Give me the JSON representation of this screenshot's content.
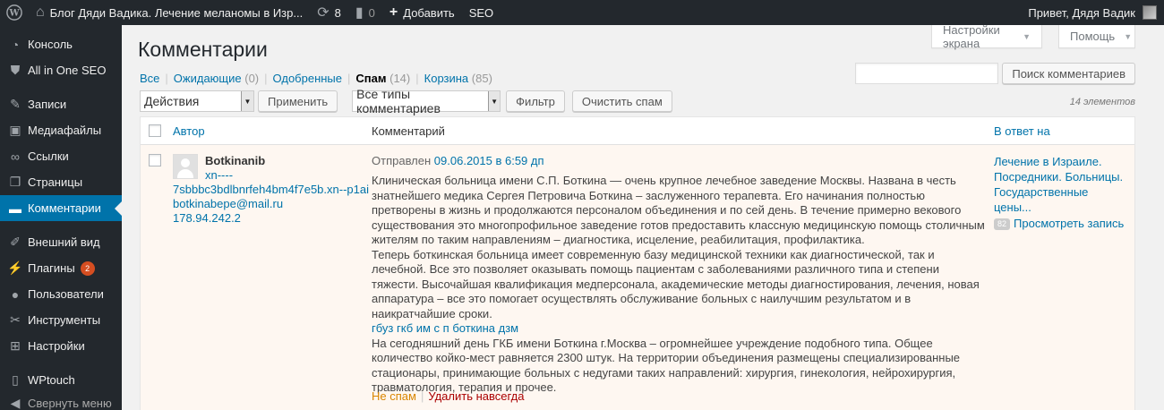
{
  "adminbar": {
    "site_title": "Блог Дяди Вадика. Лечение меланомы в Изр...",
    "updates_count": "8",
    "comments_count": "0",
    "add_label": "Добавить",
    "seo_label": "SEO",
    "greeting": "Привет, Дядя Вадик"
  },
  "sidebar": {
    "items": [
      {
        "label": "Консоль",
        "icon": "dashboard-icon"
      },
      {
        "label": "All in One SEO",
        "icon": "shield-icon"
      },
      {
        "label": "Записи",
        "icon": "pin-icon"
      },
      {
        "label": "Медиафайлы",
        "icon": "media-icon"
      },
      {
        "label": "Ссылки",
        "icon": "link-icon"
      },
      {
        "label": "Страницы",
        "icon": "page-icon"
      },
      {
        "label": "Комментарии",
        "icon": "comment-icon"
      },
      {
        "label": "Внешний вид",
        "icon": "brush-icon"
      },
      {
        "label": "Плагины",
        "icon": "plugin-icon",
        "badge": "2"
      },
      {
        "label": "Пользователи",
        "icon": "user-icon"
      },
      {
        "label": "Инструменты",
        "icon": "wrench-icon"
      },
      {
        "label": "Настройки",
        "icon": "settings-icon"
      },
      {
        "label": "WPtouch",
        "icon": "phone-icon"
      },
      {
        "label": "Свернуть меню",
        "icon": "collapse-icon"
      }
    ]
  },
  "page": {
    "title": "Комментарии",
    "screen_options": "Настройки экрана",
    "help": "Помощь"
  },
  "filters": {
    "all": "Все",
    "pending": "Ожидающие",
    "pending_count": "(0)",
    "approved": "Одобренные",
    "spam": "Спам",
    "spam_count": "(14)",
    "trash": "Корзина",
    "trash_count": "(85)"
  },
  "search": {
    "button": "Поиск комментариев"
  },
  "tablenav": {
    "bulk_select": "Действия",
    "apply": "Применить",
    "type_select": "Все типы комментариев",
    "filter": "Фильтр",
    "empty_spam": "Очистить спам",
    "displaying": "14 элементов"
  },
  "table": {
    "col_author": "Автор",
    "col_comment": "Комментарий",
    "col_response": "В ответ на"
  },
  "comment": {
    "author_name": "Botkinanib",
    "author_url_1": "xn----",
    "author_url_2": "7sbbbc3bdlbnrfeh4bm4f7e5b.xn--p1ai",
    "author_email": "botkinabepe@mail.ru",
    "author_ip": "178.94.242.2",
    "submitted_prefix": "Отправлен",
    "submitted_date": "09.06.2015 в 6:59 дп",
    "paragraph_1": "Клиническая больница имени С.П. Боткина — очень крупное лечебное заведение Москвы. Названа в честь знатнейшего медика Сергея Петровича Боткина – заслуженного терапевта. Его начинания полностью претворены в жизнь и продолжаются персоналом объединения и по сей день. В течение примерно векового существования это многопрофильное заведение готов предоставить классную медицинскую помощь столичным жителям по таким направлениям – диагностика, исцеление, реабилитация, профилактика.",
    "paragraph_2": "Теперь боткинская больница имеет современную базу медицинской техники как диагностической, так и лечебной. Все это позволяет оказывать помощь пациентам с заболеваниями различного типа и степени тяжести. Высочайшая квалификация медперсонала, академические методы диагностирования, лечения, новая аппаратура – все это помогает осуществлять обслуживание больных с наилучшим результатом и в наикратчайшие сроки.",
    "inline_link": "гбуз гкб им с п боткина дзм",
    "paragraph_3": "На сегодняшний день ГКБ имени Боткина г.Москва – огромнейшее учреждение подобного типа. Общее количество койко-мест равняется 2300 штук. На территории объединения размещены специализированные стационары, принимающие больных с недугами таких направлений: хирургия, гинекология, нейрохирургия, травматология, терапия и прочее.",
    "action_unspam": "Не спам",
    "action_delete": "Удалить навсегда",
    "response_title": "Лечение в Израиле. Посредники. Больницы. Государственные цены...",
    "response_count": "82",
    "response_view": "Просмотреть запись"
  }
}
